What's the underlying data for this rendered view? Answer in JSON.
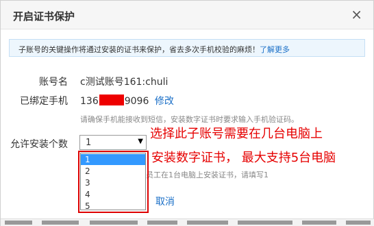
{
  "dialog": {
    "title": "开启证书保护",
    "close_label": "×"
  },
  "notice": {
    "text": "子账号的关键操作将通过安装的证书来保护，省去多次手机校验的麻烦！",
    "link": "了解更多"
  },
  "form": {
    "account_label": "账号名",
    "account_value": "c测试账号161:chuli",
    "phone_label": "已绑定手机",
    "phone_prefix": "136",
    "phone_suffix": "9096",
    "modify_link": "修改",
    "hint": "请确保手机能接收到短信，安装数字证书时要求输入手机验证码。",
    "install_label": "允许安装个数",
    "install_selected": "1",
    "install_options": [
      "1",
      "2",
      "3",
      "4",
      "5"
    ],
    "install_hint": "员工在1台电脑上安装证书，请填写1",
    "cancel_label": "取消"
  },
  "annotations": {
    "line1": "选择此子账号需要在几台电脑上",
    "line2": "安装数字证书，  最大支持5台电脑"
  },
  "colors": {
    "annotation": "#e60000",
    "link": "#1a6fc7",
    "selected_option": "#3399ff"
  }
}
